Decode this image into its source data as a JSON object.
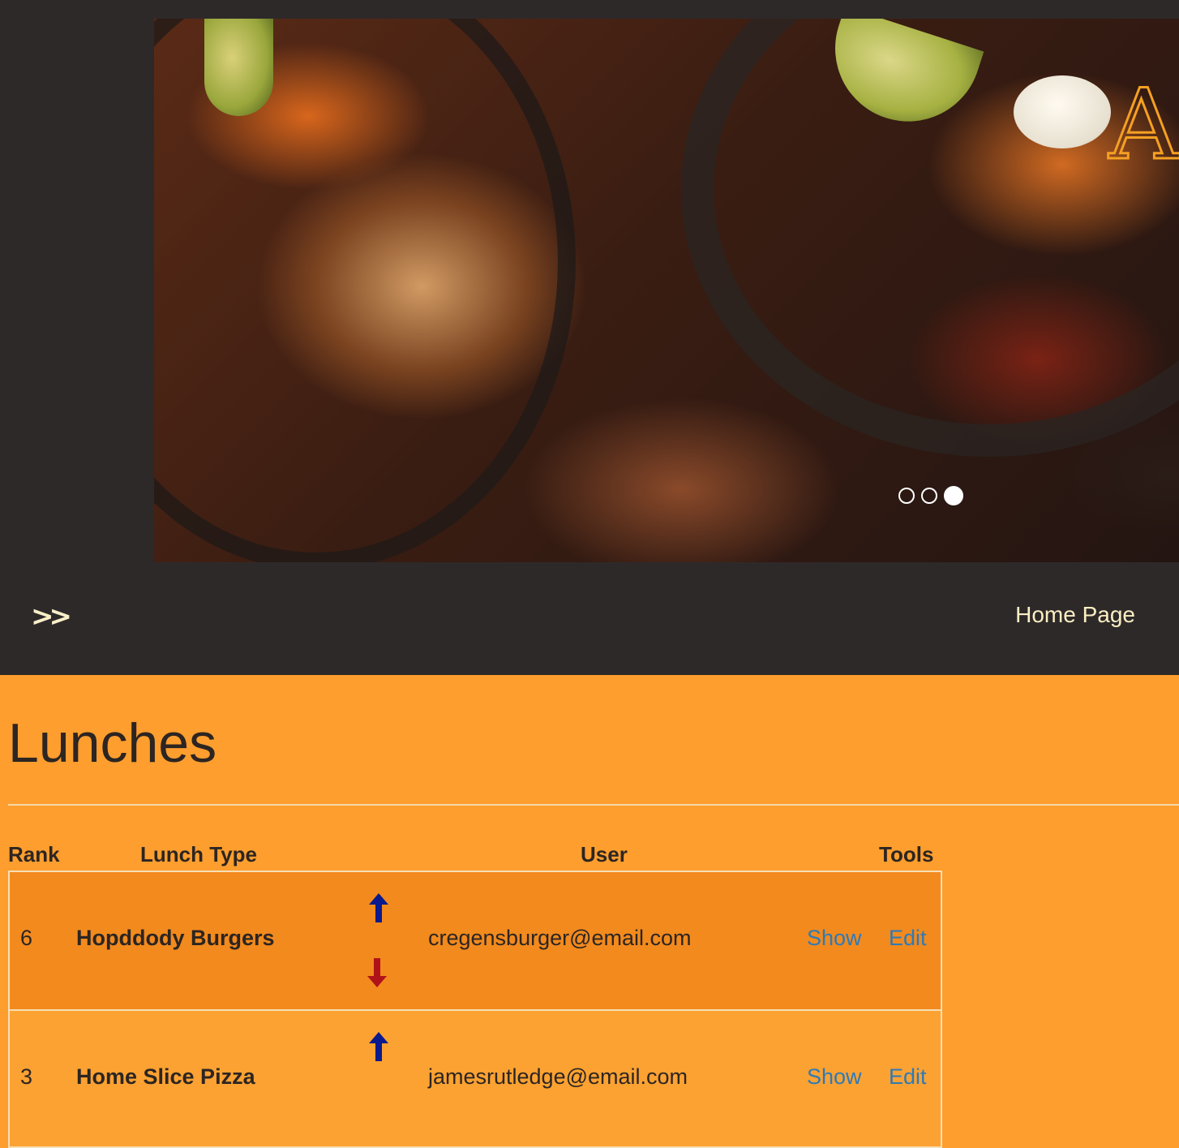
{
  "header": {
    "carousel": {
      "slides": 3,
      "active_slide": 3,
      "indicator_color": "#ffffff"
    },
    "nav_toggle_icon": "double-chevron-right-icon",
    "home_link": "Home Page",
    "background": "#2e2929",
    "link_color": "#fbeec3"
  },
  "main": {
    "title": "Lunches",
    "background": "#fd9e2e",
    "table": {
      "columns": {
        "rank": "Rank",
        "lunch_type": "Lunch Type",
        "user": "User",
        "tools": "Tools"
      },
      "rows": [
        {
          "rank": "6",
          "lunch_type": "Hopddody Burgers",
          "user": "cregensburger@email.com",
          "show": "Show",
          "edit": "Edit",
          "up_icon": "arrow-up-icon",
          "down_icon": "arrow-down-icon"
        },
        {
          "rank": "3",
          "lunch_type": "Home Slice Pizza",
          "user": "jamesrutledge@email.com",
          "show": "Show",
          "edit": "Edit",
          "up_icon": "arrow-up-icon"
        }
      ],
      "link_color": "#2e7ab6",
      "up_arrow_color": "#0b1a8c",
      "down_arrow_color": "#b0121a"
    }
  }
}
